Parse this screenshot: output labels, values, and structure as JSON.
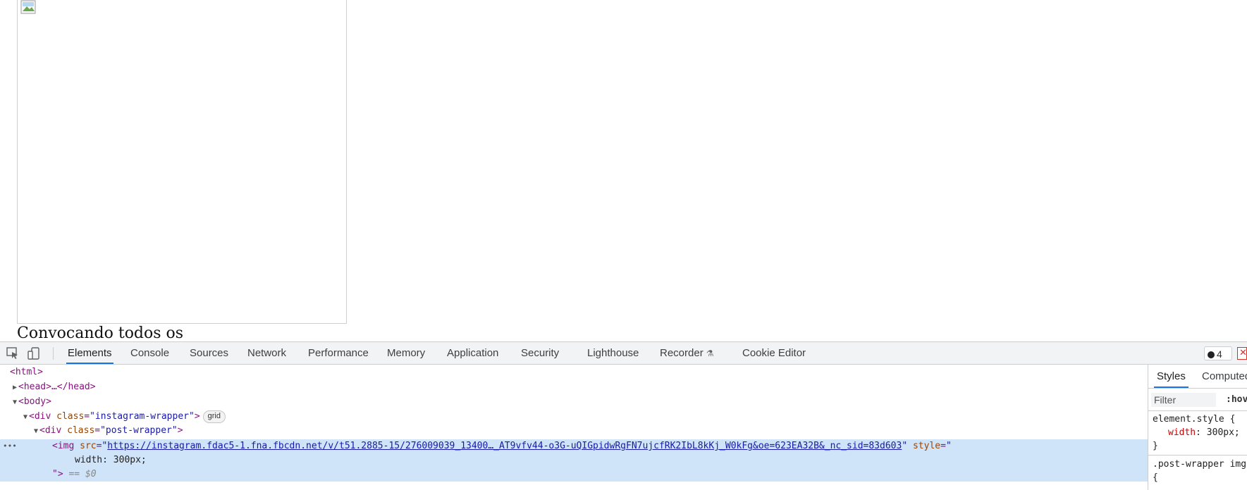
{
  "page": {
    "caption": "Convocando todos os"
  },
  "devtools": {
    "tabs": [
      {
        "label": "Elements"
      },
      {
        "label": "Console"
      },
      {
        "label": "Sources"
      },
      {
        "label": "Network"
      },
      {
        "label": "Performance"
      },
      {
        "label": "Memory"
      },
      {
        "label": "Application"
      },
      {
        "label": "Security"
      },
      {
        "label": "Lighthouse"
      },
      {
        "label": "Recorder"
      },
      {
        "label": "Cookie Editor"
      }
    ],
    "active_tab": "Elements",
    "error_count": "4",
    "accent_color": "#1a73e8",
    "selected_row_color": "#cfe3f9"
  },
  "tree": {
    "html_open": "<html>",
    "head": "<head>…</head>",
    "body_open": "<body>",
    "div1_tag": "<div ",
    "div1_attr_name": "class",
    "div1_attr_val": "\"instagram-wrapper\"",
    "div1_close": ">",
    "grid_badge": "grid",
    "div2_tag": "<div ",
    "div2_attr_name": "class",
    "div2_attr_val": "\"post-wrapper\"",
    "div2_close": ">",
    "img_tag": "<img ",
    "img_src_name": "src",
    "img_src_url": "https://instagram.fdac5-1.fna.fbcdn.net/v/t51.2885-15/276009039_13400…_AT9vfv44-o3G-uQIGpidwRgFN7ujcfRK2IbL8kKj_W0kFg&oe=623EA32B&_nc_sid=83d603",
    "img_style_name": "style",
    "img_style_value": "width: 300px;",
    "img_end": "\">",
    "eq0": "== $0"
  },
  "styles": {
    "tabs": [
      "Styles",
      "Computed"
    ],
    "filter_placeholder": "Filter",
    "hov": ":hov",
    "element_style_selector": "element.style {",
    "element_style_prop": "width",
    "element_style_value": "300px;",
    "close_brace": "}",
    "post_wrapper_selector": ".post-wrapper img",
    "open_brace": "{"
  }
}
